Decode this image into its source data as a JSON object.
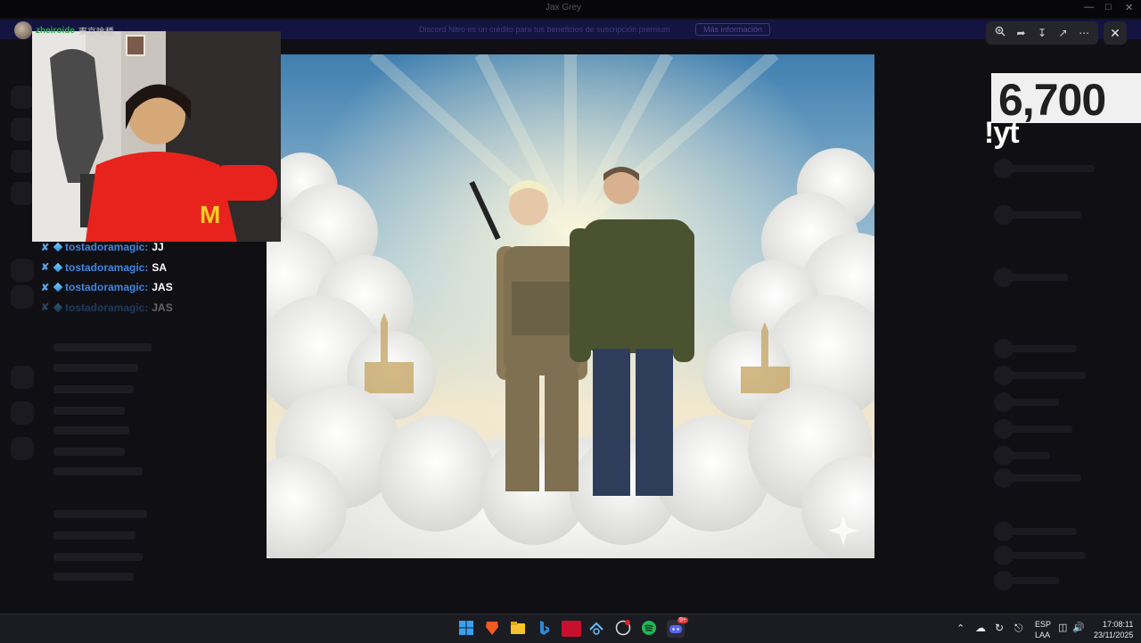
{
  "window": {
    "title": "Jax Grey"
  },
  "banner": {
    "text": "Discord Nitro es un crédito para tus beneficios de suscripción premium",
    "button": "Más información"
  },
  "stream": {
    "username": "zheiroide",
    "badge_text": "東京喰種"
  },
  "chat": [
    {
      "user": "tostadoramagic:",
      "message": "JJ"
    },
    {
      "user": "tostadoramagic:",
      "message": "SA"
    },
    {
      "user": "tostadoramagic:",
      "message": "JAS"
    },
    {
      "user": "tostadoramagic:",
      "message": "JAS"
    }
  ],
  "counter": {
    "value": "6,700"
  },
  "command_text": "!yt",
  "viewer_toolbar": {
    "icons": [
      "zoom-in-icon",
      "forward-icon",
      "download-icon",
      "open-external-icon",
      "more-icon"
    ],
    "close_icon": "close-icon"
  },
  "taskbar": {
    "language_top": "ESP",
    "language_bottom": "LAA",
    "time": "17:08:11",
    "date": "23/11/2025",
    "discord_badge": "9+"
  },
  "colors": {
    "chat_user": "#3f86e4",
    "stream_name": "#2aa84a",
    "taskbar": "#1b1c22"
  }
}
